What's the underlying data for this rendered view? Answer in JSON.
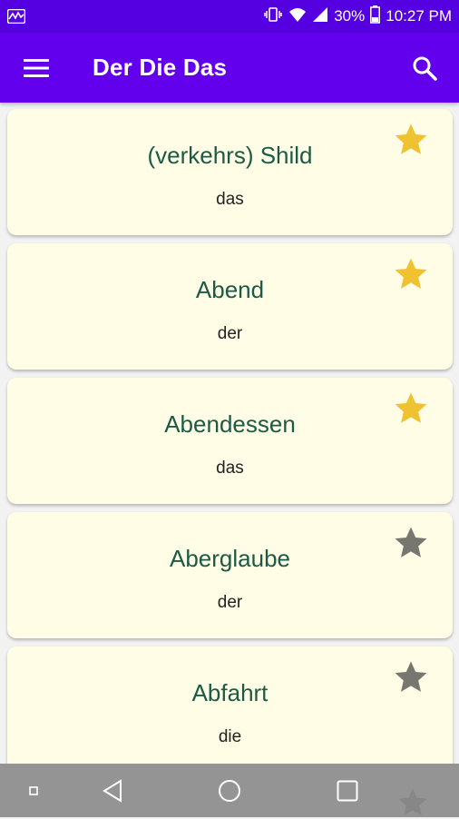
{
  "status_bar": {
    "battery": "30%",
    "time": "10:27 PM",
    "icons": [
      "activity-icon",
      "vibrate-icon",
      "wifi-icon",
      "signal-icon",
      "battery-icon"
    ]
  },
  "app_bar": {
    "title": "Der Die Das",
    "menu_icon": "hamburger-menu-icon",
    "search_icon": "search-icon",
    "color": "#6200ee"
  },
  "words": [
    {
      "word": "(verkehrs) Shild",
      "article": "das",
      "starred": true
    },
    {
      "word": "Abend",
      "article": "der",
      "starred": true
    },
    {
      "word": "Abendessen",
      "article": "das",
      "starred": true
    },
    {
      "word": "Aberglaube",
      "article": "der",
      "starred": false
    },
    {
      "word": "Abfahrt",
      "article": "die",
      "starred": false
    }
  ],
  "colors": {
    "star_active": "#f0c232",
    "star_inactive": "#777770",
    "card": "#fffde6",
    "word_text": "#1d5a45"
  },
  "nav_bar": {
    "icons": [
      "recent-dot-icon",
      "back-icon",
      "home-icon",
      "overview-icon"
    ]
  }
}
